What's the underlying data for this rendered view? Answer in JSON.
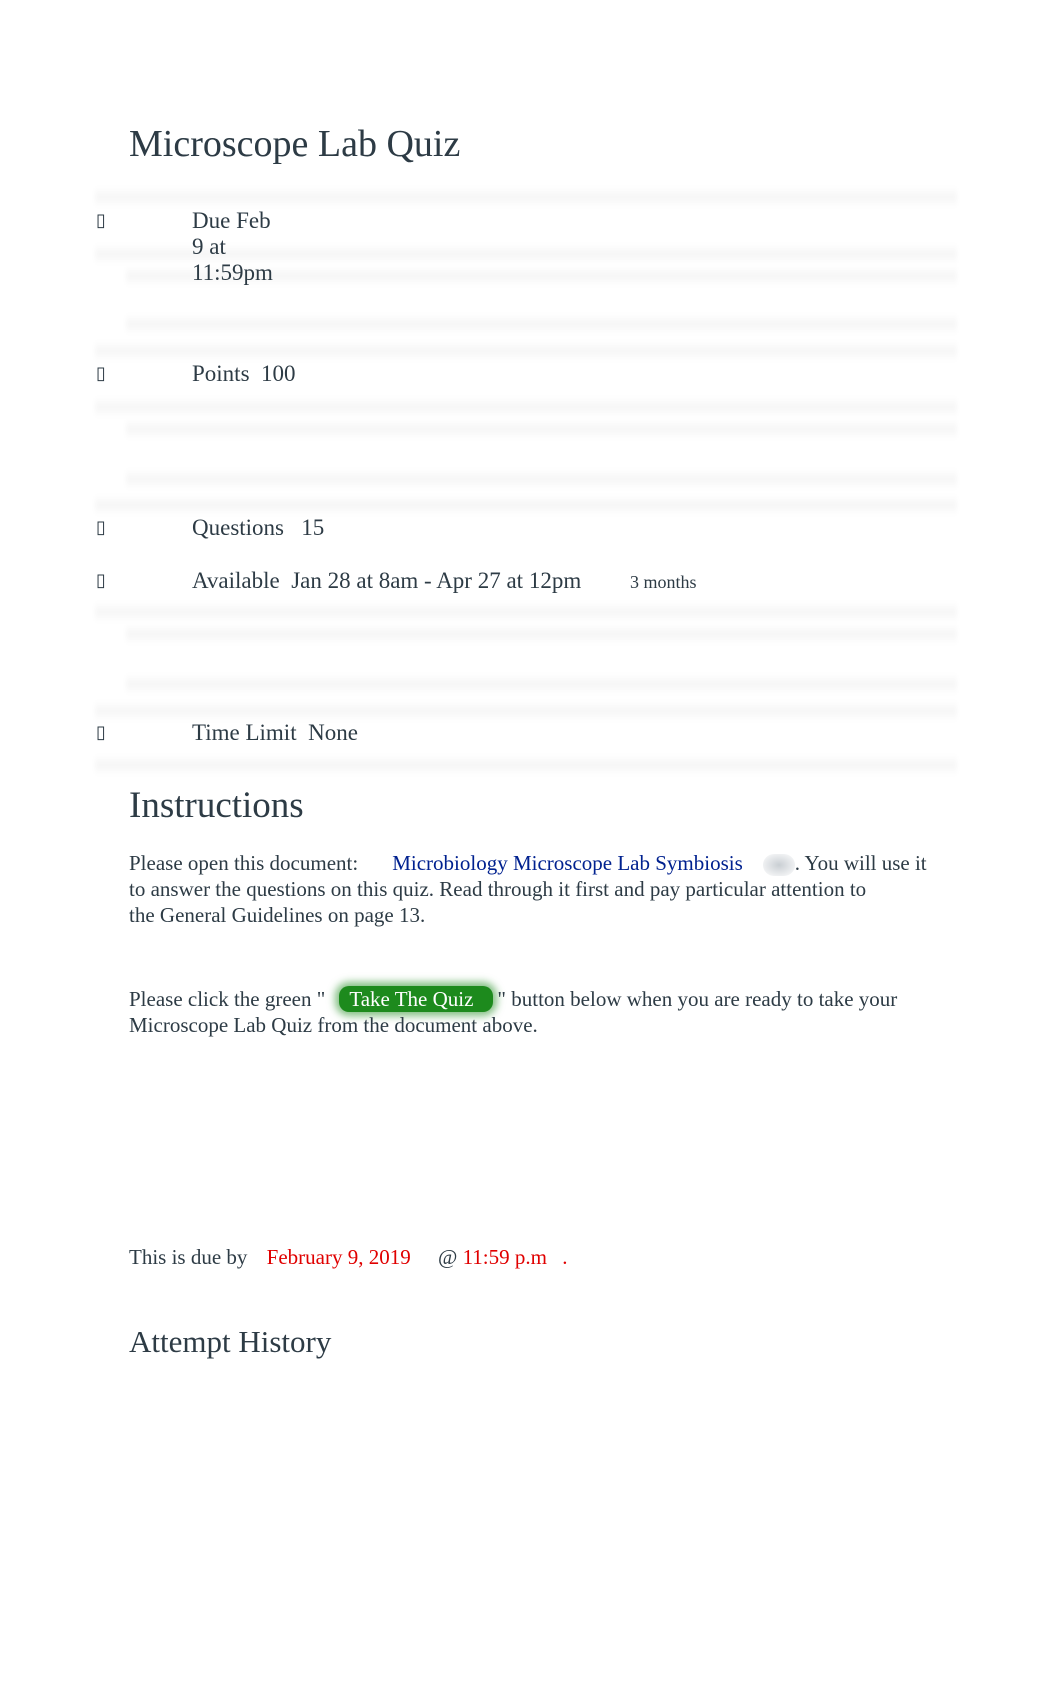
{
  "page": {
    "title": "Microscope Lab Quiz"
  },
  "details": [
    {
      "icon": "calendar-icon",
      "label": "Due Feb 9 at 11:59pm"
    },
    {
      "icon": "points-icon",
      "label": "Points  100"
    },
    {
      "icon": "questions-icon",
      "label": "Questions   15"
    },
    {
      "icon": "clock-icon",
      "label": "Available  Jan 28 at 8am - Apr 27 at 12pm",
      "extra": "3 months"
    },
    {
      "icon": "timer-icon",
      "label": "Time Limit  None"
    }
  ],
  "icon_glyph": "▯",
  "instructions": {
    "heading": "Instructions",
    "p1_prefix": "Please open this document:",
    "p1_link": "Microbiology Microscope Lab Symbiosis",
    "p1_suffix_1": ". You will use it",
    "p1_line2": "to answer the questions on this quiz. Read through it first and pay particular attention to",
    "p1_line3": "the General Guidelines on page 13.",
    "p2_prefix": "Please click the green \"",
    "p2_button": "Take The Quiz",
    "p2_suffix": "\" button below when you are ready to take your",
    "p2_line2": "Microscope Lab Quiz from the document above.",
    "due_prefix": "This is due by",
    "due_date": "February 9, 2019",
    "due_at": "@",
    "due_time": "11:59 p.m",
    "due_end": "."
  },
  "attempt_history": {
    "heading": "Attempt History"
  },
  "colors": {
    "text": "#2d3b45",
    "link": "#00218f",
    "button": "#1d8a1d",
    "due": "#e00000"
  }
}
